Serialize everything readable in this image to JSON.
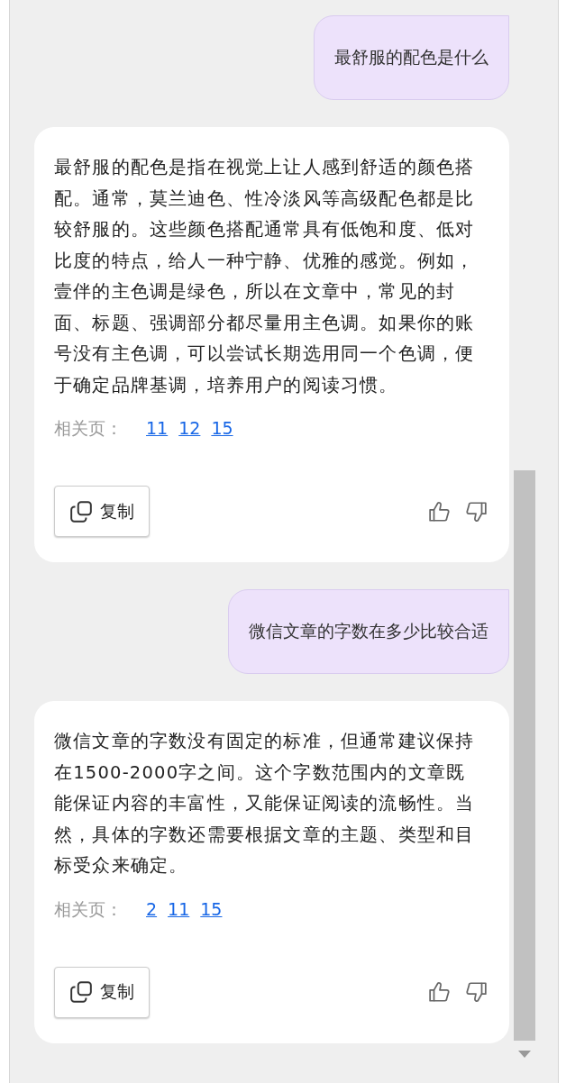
{
  "messages": [
    {
      "kind": "question",
      "text": "最舒服的配色是什么"
    },
    {
      "kind": "answer",
      "text": "最舒服的配色是指在视觉上让人感到舒适的颜色搭配。通常，莫兰迪色、性冷淡风等高级配色都是比较舒服的。这些颜色搭配通常具有低饱和度、低对比度的特点，给人一种宁静、优雅的感觉。例如，壹伴的主色调是绿色，所以在文章中，常见的封面、标题、强调部分都尽量用主色调。如果你的账号没有主色调，可以尝试长期选用同一个色调，便于确定品牌基调，培养用户的阅读习惯。",
      "related_label": "相关页：",
      "pages": [
        "11",
        "12",
        "15"
      ],
      "copy_label": "复制"
    },
    {
      "kind": "question",
      "text": "微信文章的字数在多少比较合适"
    },
    {
      "kind": "answer",
      "text": "微信文章的字数没有固定的标准，但通常建议保持在1500-2000字之间。这个字数范围内的文章既能保证内容的丰富性，又能保证阅读的流畅性。当然，具体的字数还需要根据文章的主题、类型和目标受众来确定。",
      "related_label": "相关页：",
      "pages": [
        "2",
        "11",
        "15"
      ],
      "copy_label": "复制"
    }
  ]
}
